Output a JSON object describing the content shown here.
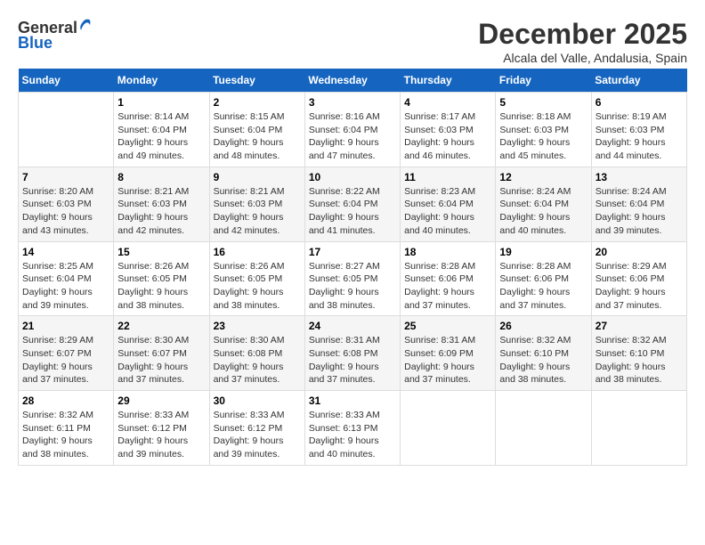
{
  "header": {
    "logo_line1": "General",
    "logo_line2": "Blue",
    "month_title": "December 2025",
    "subtitle": "Alcala del Valle, Andalusia, Spain"
  },
  "weekdays": [
    "Sunday",
    "Monday",
    "Tuesday",
    "Wednesday",
    "Thursday",
    "Friday",
    "Saturday"
  ],
  "weeks": [
    [
      {
        "day": "",
        "info": ""
      },
      {
        "day": "1",
        "info": "Sunrise: 8:14 AM\nSunset: 6:04 PM\nDaylight: 9 hours\nand 49 minutes."
      },
      {
        "day": "2",
        "info": "Sunrise: 8:15 AM\nSunset: 6:04 PM\nDaylight: 9 hours\nand 48 minutes."
      },
      {
        "day": "3",
        "info": "Sunrise: 8:16 AM\nSunset: 6:04 PM\nDaylight: 9 hours\nand 47 minutes."
      },
      {
        "day": "4",
        "info": "Sunrise: 8:17 AM\nSunset: 6:03 PM\nDaylight: 9 hours\nand 46 minutes."
      },
      {
        "day": "5",
        "info": "Sunrise: 8:18 AM\nSunset: 6:03 PM\nDaylight: 9 hours\nand 45 minutes."
      },
      {
        "day": "6",
        "info": "Sunrise: 8:19 AM\nSunset: 6:03 PM\nDaylight: 9 hours\nand 44 minutes."
      }
    ],
    [
      {
        "day": "7",
        "info": "Sunrise: 8:20 AM\nSunset: 6:03 PM\nDaylight: 9 hours\nand 43 minutes."
      },
      {
        "day": "8",
        "info": "Sunrise: 8:21 AM\nSunset: 6:03 PM\nDaylight: 9 hours\nand 42 minutes."
      },
      {
        "day": "9",
        "info": "Sunrise: 8:21 AM\nSunset: 6:03 PM\nDaylight: 9 hours\nand 42 minutes."
      },
      {
        "day": "10",
        "info": "Sunrise: 8:22 AM\nSunset: 6:04 PM\nDaylight: 9 hours\nand 41 minutes."
      },
      {
        "day": "11",
        "info": "Sunrise: 8:23 AM\nSunset: 6:04 PM\nDaylight: 9 hours\nand 40 minutes."
      },
      {
        "day": "12",
        "info": "Sunrise: 8:24 AM\nSunset: 6:04 PM\nDaylight: 9 hours\nand 40 minutes."
      },
      {
        "day": "13",
        "info": "Sunrise: 8:24 AM\nSunset: 6:04 PM\nDaylight: 9 hours\nand 39 minutes."
      }
    ],
    [
      {
        "day": "14",
        "info": "Sunrise: 8:25 AM\nSunset: 6:04 PM\nDaylight: 9 hours\nand 39 minutes."
      },
      {
        "day": "15",
        "info": "Sunrise: 8:26 AM\nSunset: 6:05 PM\nDaylight: 9 hours\nand 38 minutes."
      },
      {
        "day": "16",
        "info": "Sunrise: 8:26 AM\nSunset: 6:05 PM\nDaylight: 9 hours\nand 38 minutes."
      },
      {
        "day": "17",
        "info": "Sunrise: 8:27 AM\nSunset: 6:05 PM\nDaylight: 9 hours\nand 38 minutes."
      },
      {
        "day": "18",
        "info": "Sunrise: 8:28 AM\nSunset: 6:06 PM\nDaylight: 9 hours\nand 37 minutes."
      },
      {
        "day": "19",
        "info": "Sunrise: 8:28 AM\nSunset: 6:06 PM\nDaylight: 9 hours\nand 37 minutes."
      },
      {
        "day": "20",
        "info": "Sunrise: 8:29 AM\nSunset: 6:06 PM\nDaylight: 9 hours\nand 37 minutes."
      }
    ],
    [
      {
        "day": "21",
        "info": "Sunrise: 8:29 AM\nSunset: 6:07 PM\nDaylight: 9 hours\nand 37 minutes."
      },
      {
        "day": "22",
        "info": "Sunrise: 8:30 AM\nSunset: 6:07 PM\nDaylight: 9 hours\nand 37 minutes."
      },
      {
        "day": "23",
        "info": "Sunrise: 8:30 AM\nSunset: 6:08 PM\nDaylight: 9 hours\nand 37 minutes."
      },
      {
        "day": "24",
        "info": "Sunrise: 8:31 AM\nSunset: 6:08 PM\nDaylight: 9 hours\nand 37 minutes."
      },
      {
        "day": "25",
        "info": "Sunrise: 8:31 AM\nSunset: 6:09 PM\nDaylight: 9 hours\nand 37 minutes."
      },
      {
        "day": "26",
        "info": "Sunrise: 8:32 AM\nSunset: 6:10 PM\nDaylight: 9 hours\nand 38 minutes."
      },
      {
        "day": "27",
        "info": "Sunrise: 8:32 AM\nSunset: 6:10 PM\nDaylight: 9 hours\nand 38 minutes."
      }
    ],
    [
      {
        "day": "28",
        "info": "Sunrise: 8:32 AM\nSunset: 6:11 PM\nDaylight: 9 hours\nand 38 minutes."
      },
      {
        "day": "29",
        "info": "Sunrise: 8:33 AM\nSunset: 6:12 PM\nDaylight: 9 hours\nand 39 minutes."
      },
      {
        "day": "30",
        "info": "Sunrise: 8:33 AM\nSunset: 6:12 PM\nDaylight: 9 hours\nand 39 minutes."
      },
      {
        "day": "31",
        "info": "Sunrise: 8:33 AM\nSunset: 6:13 PM\nDaylight: 9 hours\nand 40 minutes."
      },
      {
        "day": "",
        "info": ""
      },
      {
        "day": "",
        "info": ""
      },
      {
        "day": "",
        "info": ""
      }
    ]
  ]
}
